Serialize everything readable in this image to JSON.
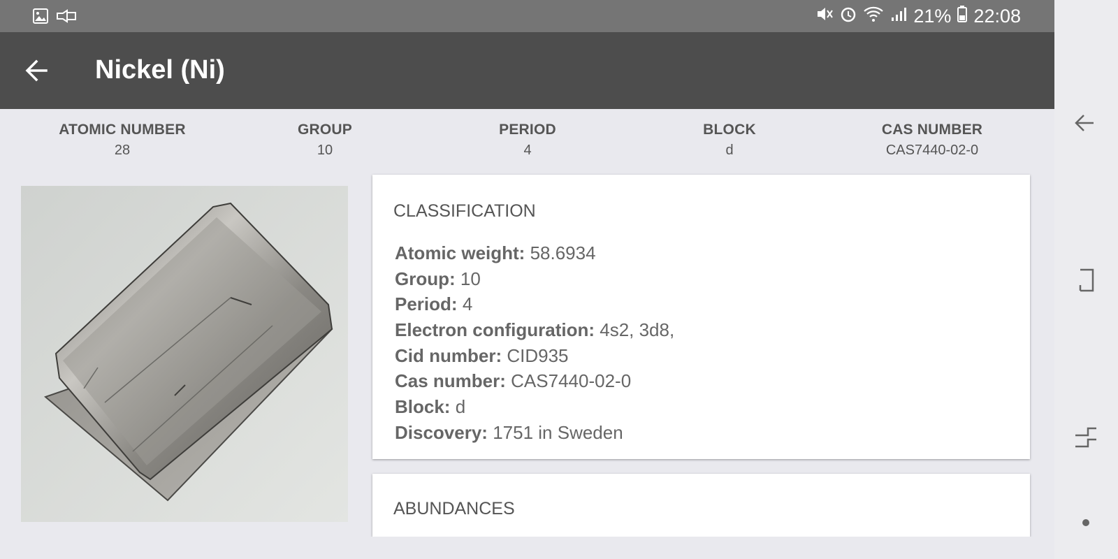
{
  "status_bar": {
    "battery": "21%",
    "time": "22:08",
    "left_icons": [
      "gallery-icon",
      "flashlight-icon"
    ],
    "right_icons": [
      "mute-icon",
      "alarm-icon",
      "wifi-icon",
      "signal-icon",
      "battery-icon"
    ]
  },
  "app_bar": {
    "title": "Nickel (Ni)",
    "back_icon": "back-arrow-icon",
    "color": "#4d4d4d"
  },
  "summary": [
    {
      "label": "ATOMIC NUMBER",
      "value": "28"
    },
    {
      "label": "GROUP",
      "value": "10"
    },
    {
      "label": "PERIOD",
      "value": "4"
    },
    {
      "label": "BLOCK",
      "value": "d"
    },
    {
      "label": "CAS NUMBER",
      "value": "CAS7440-02-0"
    }
  ],
  "classification": {
    "title": "CLASSIFICATION",
    "rows": [
      {
        "key": "Atomic weight:",
        "value": "58.6934"
      },
      {
        "key": "Group:",
        "value": "10"
      },
      {
        "key": "Period:",
        "value": "4"
      },
      {
        "key": "Electron configuration:",
        "value": "4s2, 3d8,"
      },
      {
        "key": "Cid number:",
        "value": "CID935"
      },
      {
        "key": "Cas number:",
        "value": "CAS7440-02-0"
      },
      {
        "key": "Block:",
        "value": "d"
      },
      {
        "key": "Discovery:",
        "value": "1751 in Sweden"
      }
    ]
  },
  "abundances": {
    "title": "ABUNDANCES"
  },
  "nav_rail": {
    "icons": [
      "nav-back-icon",
      "nav-recents-icon",
      "nav-home-icon",
      "nav-dot-icon"
    ]
  }
}
